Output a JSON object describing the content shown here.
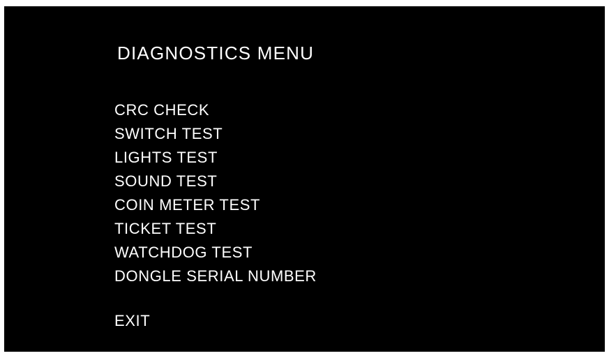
{
  "title": "DIAGNOSTICS MENU",
  "menu_items": [
    {
      "label": "CRC CHECK"
    },
    {
      "label": "SWITCH TEST"
    },
    {
      "label": "LIGHTS TEST"
    },
    {
      "label": "SOUND TEST"
    },
    {
      "label": "COIN METER TEST"
    },
    {
      "label": "TICKET TEST"
    },
    {
      "label": "WATCHDOG TEST"
    },
    {
      "label": "DONGLE SERIAL NUMBER"
    }
  ],
  "exit_label": "EXIT",
  "colors": {
    "background": "#000000",
    "text": "#ffffff",
    "frame": "#ffffff"
  }
}
